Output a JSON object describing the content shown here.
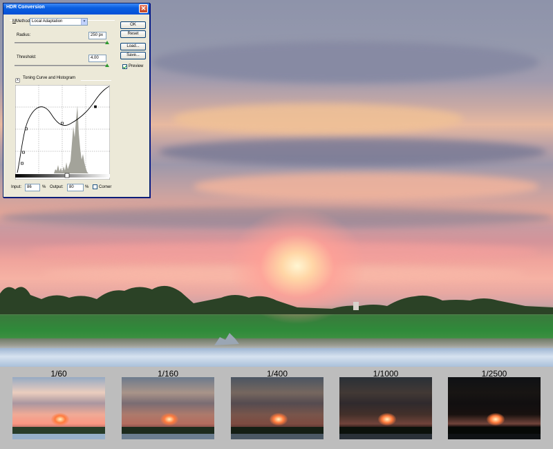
{
  "dialog": {
    "title": "HDR Conversion",
    "method_label": "Method:",
    "method_value": "Local Adaptation",
    "radius_label": "Radius:",
    "radius_value": "250 px",
    "threshold_label": "Threshold:",
    "threshold_value": "4.00",
    "curve_section_label": "Toning Curve and Histogram",
    "input_label": "Input:",
    "input_value": "86",
    "input_unit": "%",
    "output_label": "Output:",
    "output_value": "80",
    "output_unit": "%",
    "corner_label": "Corner",
    "corner_checked": false,
    "buttons": {
      "ok": "OK",
      "reset": "Reset",
      "load": "Load...",
      "save": "Save..."
    },
    "preview_label": "Preview",
    "preview_checked": true,
    "close_icon": "close-icon"
  },
  "brackets": [
    {
      "label": "1/60",
      "exposure": 1.0
    },
    {
      "label": "1/160",
      "exposure": 0.72
    },
    {
      "label": "1/400",
      "exposure": 0.5
    },
    {
      "label": "1/1000",
      "exposure": 0.28
    },
    {
      "label": "1/2500",
      "exposure": 0.1
    }
  ],
  "colors": {
    "titlebar": "#0550d6",
    "dialog_bg": "#ece9d8",
    "slider_thumb": "#2f9b2f",
    "page_bg": "#bdbdbd"
  }
}
